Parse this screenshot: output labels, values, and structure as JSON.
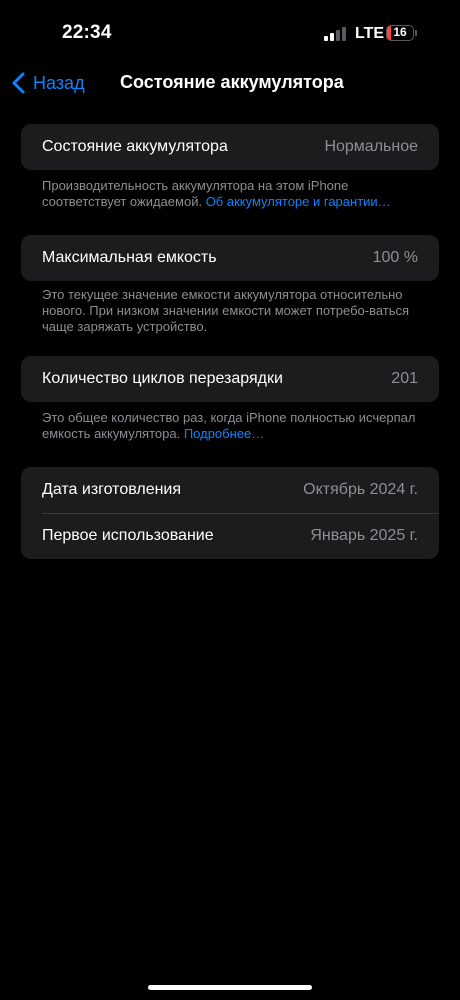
{
  "status_bar": {
    "time": "22:34",
    "network": "LTE",
    "battery_level": "16",
    "battery_fraction": 0.16,
    "signal_bars_active": 2,
    "signal_bars_total": 4,
    "signal_icon": "cellular-signal-icon",
    "battery_icon": "battery-icon"
  },
  "nav": {
    "back_label": "Назад",
    "back_icon": "chevron-left-icon",
    "title": "Состояние аккумулятора"
  },
  "sections": {
    "health": {
      "label": "Состояние аккумулятора",
      "value": "Нормальное",
      "footnote_text": "Производительность аккумулятора на этом iPhone соответствует ожидаемой. ",
      "footnote_link": "Об аккумуляторе и гарантии…"
    },
    "capacity": {
      "label": "Максимальная емкость",
      "value": "100 %",
      "footnote_text": "Это текущее значение емкости аккумулятора относительно нового. При низком значении емкости может потребо-ваться чаще заряжать устройство."
    },
    "cycles": {
      "label": "Количество циклов перезарядки",
      "value": "201",
      "footnote_text": "Это общее количество раз, когда iPhone полностью исчерпал емкость аккумулятора. ",
      "footnote_link": "Подробнее…"
    },
    "dates": {
      "manufacture_label": "Дата изготовления",
      "manufacture_value": "Октябрь 2024 г.",
      "first_use_label": "Первое использование",
      "first_use_value": "Январь 2025 г."
    }
  },
  "colors": {
    "background": "#000000",
    "group_background": "#1c1c1e",
    "accent": "#0a84ff",
    "secondary_text": "#8e8e93",
    "battery_low": "#ff453a"
  }
}
